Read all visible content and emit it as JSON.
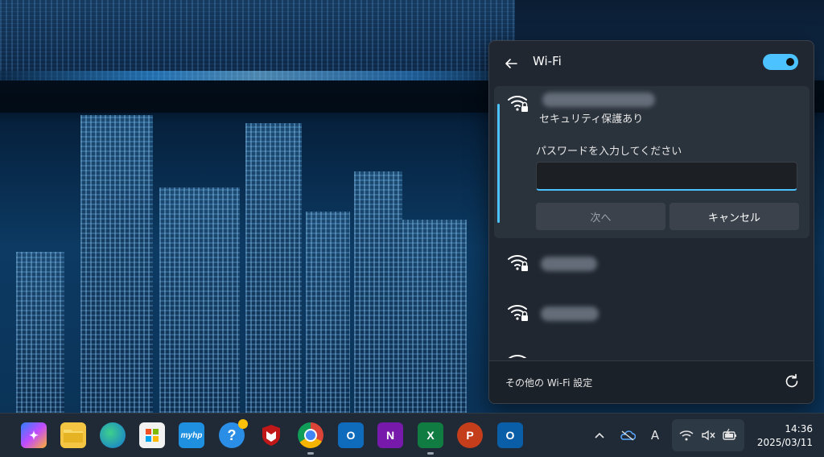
{
  "flyout": {
    "title": "Wi-Fi",
    "wifi_enabled": true,
    "selected_network": {
      "security_text": "セキュリティ保護あり",
      "password_label": "パスワードを入力してください",
      "password_value": "",
      "next_label": "次へ",
      "cancel_label": "キャンセル"
    },
    "footer_link": "その他の Wi-Fi 設定"
  },
  "taskbar": {
    "apps": [
      {
        "name": "copilot-app"
      },
      {
        "name": "file-explorer-app"
      },
      {
        "name": "edge-app"
      },
      {
        "name": "microsoft-store-app"
      },
      {
        "name": "myhp-app",
        "text": "myhp"
      },
      {
        "name": "help-app",
        "text": "?"
      },
      {
        "name": "mcafee-app"
      },
      {
        "name": "chrome-app"
      },
      {
        "name": "outlook-app",
        "text": "O"
      },
      {
        "name": "onenote-app",
        "text": "N"
      },
      {
        "name": "excel-app",
        "text": "X"
      },
      {
        "name": "powerpoint-app",
        "text": "P"
      },
      {
        "name": "outlook-new-app",
        "text": "O"
      }
    ],
    "tray": {
      "ime_indicator": "A"
    },
    "clock": {
      "time": "14:36",
      "date": "2025/03/11"
    }
  },
  "colors": {
    "accent": "#4cc2ff",
    "flyout_bg": "#202731",
    "taskbar_bg": "#1f2a36"
  }
}
